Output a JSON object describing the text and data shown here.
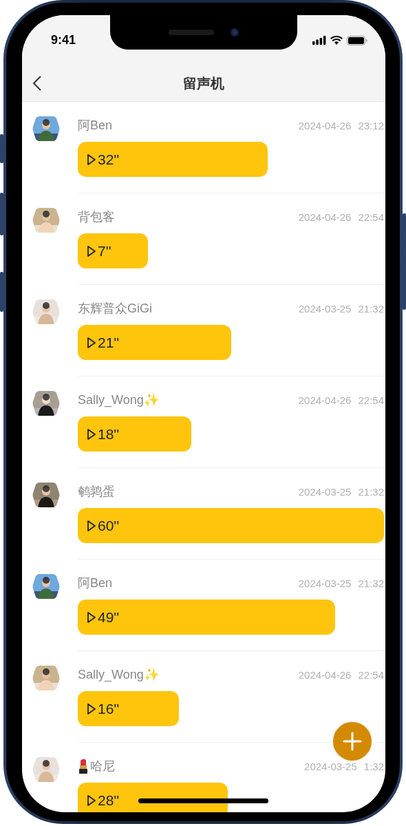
{
  "status_bar": {
    "time": "9:41"
  },
  "header": {
    "title": "留声机"
  },
  "messages": [
    {
      "name": "阿Ben",
      "has_prefix_icon": false,
      "date": "2024-04-26",
      "time": "23:12",
      "duration": "32''",
      "level": 0.62
    },
    {
      "name": "背包客",
      "has_prefix_icon": false,
      "date": "2024-04-26",
      "time": "22:54",
      "duration": "7''",
      "level": 0.23
    },
    {
      "name": "东辉普众GiGi",
      "has_prefix_icon": false,
      "date": "2024-03-25",
      "time": "21:32",
      "duration": "21''",
      "level": 0.5
    },
    {
      "name": "Sally_Wong✨",
      "has_prefix_icon": false,
      "date": "2024-04-26",
      "time": "22:54",
      "duration": "18''",
      "level": 0.37
    },
    {
      "name": "鹌鹑蛋",
      "has_prefix_icon": false,
      "date": "2024-03-25",
      "time": "21:32",
      "duration": "60''",
      "level": 1
    },
    {
      "name": "阿Ben",
      "has_prefix_icon": false,
      "date": "2024-03-25",
      "time": "21:32",
      "duration": "49''",
      "level": 0.84
    },
    {
      "name": "Sally_Wong✨",
      "has_prefix_icon": false,
      "date": "2024-04-26",
      "time": "22:54",
      "duration": "16''",
      "level": 0.33
    },
    {
      "name": "哈尼",
      "has_prefix_icon": true,
      "date": "2024-03-25",
      "time": "1:32",
      "duration": "28''",
      "level": 0.49
    }
  ]
}
